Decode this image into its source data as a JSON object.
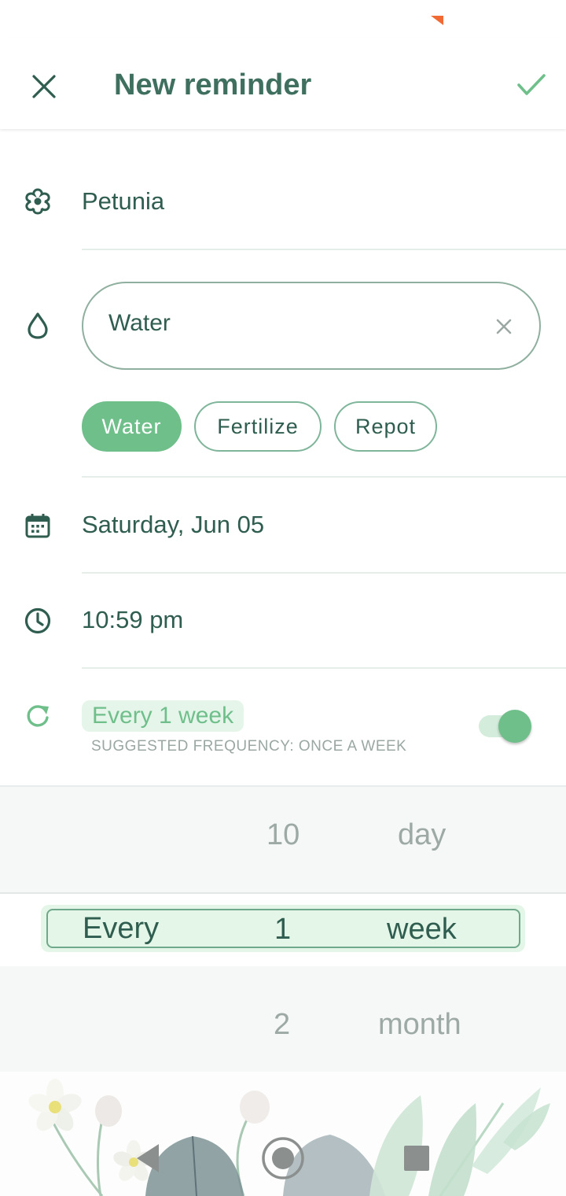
{
  "app_bar": {
    "title": "New reminder",
    "close_icon": "close-icon",
    "confirm_icon": "check-icon"
  },
  "plant": {
    "icon": "flower-icon",
    "name": "Petunia"
  },
  "task": {
    "icon": "water-drop-icon",
    "value": "Water",
    "clear_icon": "clear-icon",
    "chips": [
      {
        "label": "Water",
        "selected": true
      },
      {
        "label": "Fertilize",
        "selected": false
      },
      {
        "label": "Repot",
        "selected": false
      }
    ]
  },
  "date": {
    "icon": "calendar-icon",
    "value": "Saturday, Jun 05"
  },
  "time": {
    "icon": "clock-icon",
    "value": "10:59 pm"
  },
  "repeat": {
    "icon": "repeat-icon",
    "frequency": "Every 1 week",
    "suggestion": "SUGGESTED FREQUENCY: ONCE A WEEK",
    "enabled": true
  },
  "picker": {
    "above": {
      "number": "10",
      "unit": "day"
    },
    "selected": {
      "prefix": "Every",
      "number": "1",
      "unit": "week"
    },
    "below": {
      "number": "2",
      "unit": "month"
    }
  },
  "colors": {
    "primary": "#6fbf8b",
    "text": "#2f5d4f",
    "title": "#3f6f5f",
    "status_mark": "#f26a33"
  },
  "nav": {
    "back_icon": "back-icon",
    "home_icon": "home-icon",
    "recents_icon": "recents-icon"
  }
}
